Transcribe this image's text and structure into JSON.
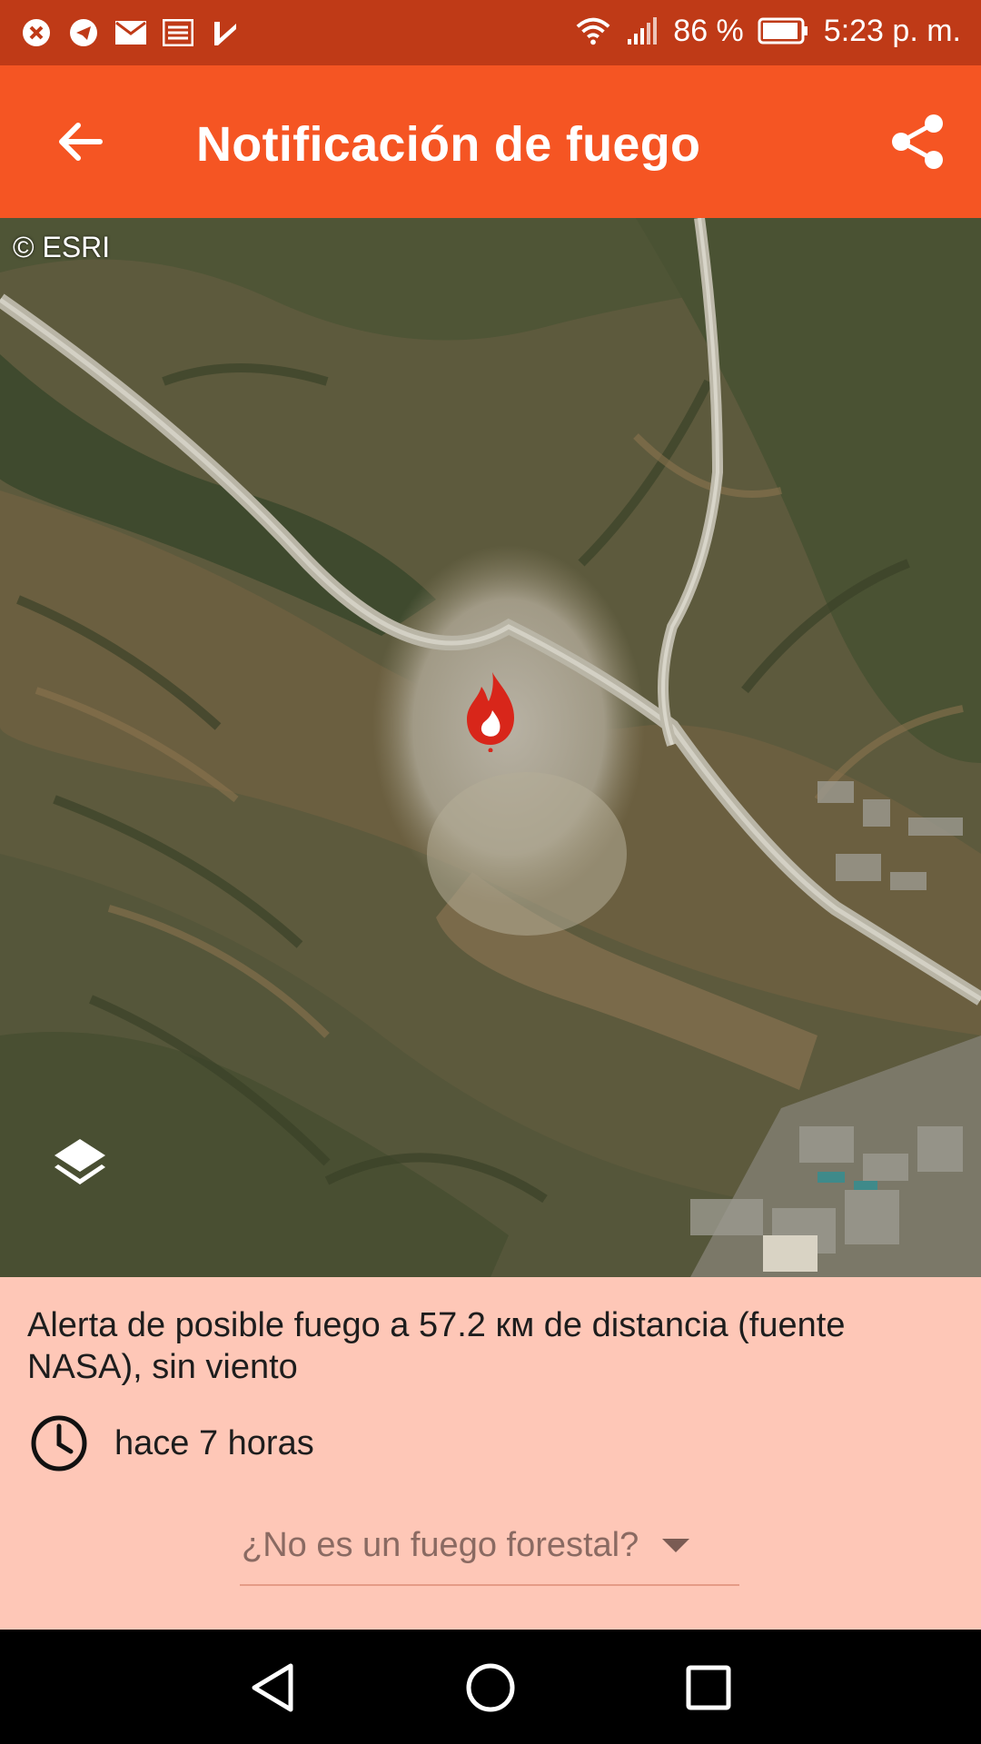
{
  "status_bar": {
    "battery_percent": "86 %",
    "time": "5:23 p. m.",
    "notification_icons": [
      "close-circle-icon",
      "telegram-icon",
      "mail-icon",
      "news-icon",
      "check-icon"
    ],
    "system_icons": [
      "wifi-icon",
      "signal-icon",
      "battery-icon"
    ]
  },
  "app_bar": {
    "title": "Notificación de fuego",
    "back_icon": "arrow-back-icon",
    "share_icon": "share-icon",
    "color": "#F55523"
  },
  "map": {
    "attribution": "© ESRI",
    "marker_icon": "fire-icon",
    "layers_icon": "layers-icon"
  },
  "alert": {
    "text": "Alerta de posible fuego a 57.2 км de distancia (fuente NASA), sin viento",
    "time": "hace 7 horas",
    "time_icon": "clock-icon",
    "feedback_label": "¿No es un fuego forestal?",
    "panel_color": "#FEC7B7"
  },
  "nav_bar": {
    "icons": [
      "back-triangle-icon",
      "home-circle-icon",
      "recents-square-icon"
    ]
  }
}
